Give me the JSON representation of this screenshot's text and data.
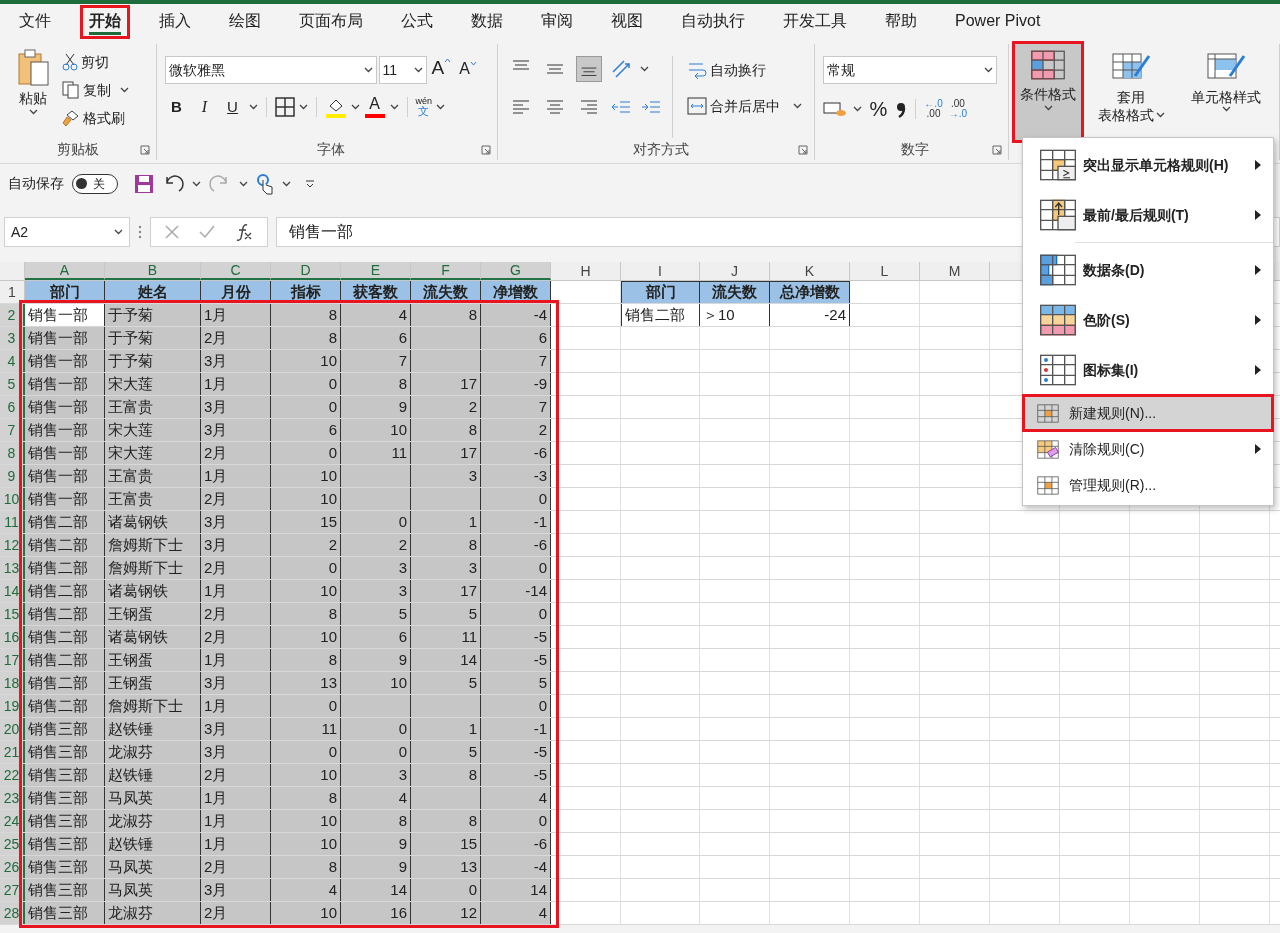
{
  "tabs": [
    {
      "label": "文件",
      "selected": false
    },
    {
      "label": "开始",
      "selected": true,
      "annotated": true
    },
    {
      "label": "插入",
      "selected": false
    },
    {
      "label": "绘图",
      "selected": false
    },
    {
      "label": "页面布局",
      "selected": false
    },
    {
      "label": "公式",
      "selected": false
    },
    {
      "label": "数据",
      "selected": false
    },
    {
      "label": "审阅",
      "selected": false
    },
    {
      "label": "视图",
      "selected": false
    },
    {
      "label": "自动执行",
      "selected": false
    },
    {
      "label": "开发工具",
      "selected": false
    },
    {
      "label": "帮助",
      "selected": false
    },
    {
      "label": "Power Pivot",
      "selected": false
    }
  ],
  "clipboard": {
    "paste": "粘贴",
    "cut": "剪切",
    "copy": "复制",
    "format_painter": "格式刷",
    "group_label": "剪贴板"
  },
  "font": {
    "font_name": "微软雅黑",
    "font_size": "11",
    "grow": "A",
    "shrink": "A",
    "bold": "B",
    "italic": "I",
    "underline": "U",
    "font_color": "A",
    "phonetic": [
      "wén",
      "文"
    ],
    "group_label": "字体"
  },
  "alignment": {
    "wrap_text": "自动换行",
    "merge_center": "合并后居中",
    "group_label": "对齐方式"
  },
  "number": {
    "format": "常规",
    "percent": "%",
    "increase_decimal": [
      "←.0",
      ".00"
    ],
    "decrease_decimal": [
      ".00",
      "→.0"
    ],
    "group_label": "数字"
  },
  "styles": {
    "conditional_formatting": {
      "label": "条件格式",
      "expanded": true,
      "annotated": true
    },
    "table_format": [
      "套用",
      "表格格式"
    ],
    "cell_styles": "单元格样式"
  },
  "quick_access": {
    "autosave_label": "自动保存",
    "autosave": {
      "on": false,
      "label": "关"
    }
  },
  "name_box": "A2",
  "formula": "销售一部",
  "column_headers": [
    "A",
    "B",
    "C",
    "D",
    "E",
    "F",
    "G",
    "H",
    "I",
    "J",
    "K",
    "L",
    "M"
  ],
  "row_numbers": [
    "1",
    "2",
    "3",
    "4",
    "5",
    "6",
    "7",
    "8",
    "9",
    "10",
    "11",
    "12",
    "13",
    "14",
    "15",
    "16",
    "17",
    "18",
    "19",
    "20",
    "21",
    "22",
    "23",
    "24",
    "25",
    "26",
    "27",
    "28"
  ],
  "main_table": {
    "selection_annotated": true,
    "header": [
      "部门",
      "姓名",
      "月份",
      "指标",
      "获客数",
      "流失数",
      "净增数"
    ],
    "rows": [
      {
        "selected": true,
        "active": true,
        "cells": [
          "销售一部",
          "于予菊",
          "1月",
          "8",
          "4",
          "8",
          "-4"
        ]
      },
      {
        "selected": true,
        "active": false,
        "cells": [
          "销售一部",
          "于予菊",
          "2月",
          "8",
          "6",
          "",
          "6"
        ]
      },
      {
        "selected": true,
        "active": false,
        "cells": [
          "销售一部",
          "于予菊",
          "3月",
          "10",
          "7",
          "",
          "7"
        ]
      },
      {
        "selected": true,
        "active": false,
        "cells": [
          "销售一部",
          "宋大莲",
          "1月",
          "0",
          "8",
          "17",
          "-9"
        ]
      },
      {
        "selected": true,
        "active": false,
        "cells": [
          "销售一部",
          "王富贵",
          "3月",
          "0",
          "9",
          "2",
          "7"
        ]
      },
      {
        "selected": true,
        "active": false,
        "cells": [
          "销售一部",
          "宋大莲",
          "3月",
          "6",
          "10",
          "8",
          "2"
        ]
      },
      {
        "selected": true,
        "active": false,
        "cells": [
          "销售一部",
          "宋大莲",
          "2月",
          "0",
          "11",
          "17",
          "-6"
        ]
      },
      {
        "selected": true,
        "active": false,
        "cells": [
          "销售一部",
          "王富贵",
          "1月",
          "10",
          "",
          "3",
          "-3"
        ]
      },
      {
        "selected": true,
        "active": false,
        "cells": [
          "销售一部",
          "王富贵",
          "2月",
          "10",
          "",
          "",
          "0"
        ]
      },
      {
        "selected": true,
        "active": false,
        "cells": [
          "销售二部",
          "诸葛钢铁",
          "3月",
          "15",
          "0",
          "1",
          "-1"
        ]
      },
      {
        "selected": true,
        "active": false,
        "cells": [
          "销售二部",
          "詹姆斯下士",
          "3月",
          "2",
          "2",
          "8",
          "-6"
        ]
      },
      {
        "selected": true,
        "active": false,
        "cells": [
          "销售二部",
          "詹姆斯下士",
          "2月",
          "0",
          "3",
          "3",
          "0"
        ]
      },
      {
        "selected": true,
        "active": false,
        "cells": [
          "销售二部",
          "诸葛钢铁",
          "1月",
          "10",
          "3",
          "17",
          "-14"
        ]
      },
      {
        "selected": true,
        "active": false,
        "cells": [
          "销售二部",
          "王钢蛋",
          "2月",
          "8",
          "5",
          "5",
          "0"
        ]
      },
      {
        "selected": true,
        "active": false,
        "cells": [
          "销售二部",
          "诸葛钢铁",
          "2月",
          "10",
          "6",
          "11",
          "-5"
        ]
      },
      {
        "selected": true,
        "active": false,
        "cells": [
          "销售二部",
          "王钢蛋",
          "1月",
          "8",
          "9",
          "14",
          "-5"
        ]
      },
      {
        "selected": true,
        "active": false,
        "cells": [
          "销售二部",
          "王钢蛋",
          "3月",
          "13",
          "10",
          "5",
          "5"
        ]
      },
      {
        "selected": true,
        "active": false,
        "cells": [
          "销售二部",
          "詹姆斯下士",
          "1月",
          "0",
          "",
          "",
          "0"
        ]
      },
      {
        "selected": true,
        "active": false,
        "cells": [
          "销售三部",
          "赵铁锤",
          "3月",
          "11",
          "0",
          "1",
          "-1"
        ]
      },
      {
        "selected": true,
        "active": false,
        "cells": [
          "销售三部",
          "龙淑芬",
          "3月",
          "0",
          "0",
          "5",
          "-5"
        ]
      },
      {
        "selected": true,
        "active": false,
        "cells": [
          "销售三部",
          "赵铁锤",
          "2月",
          "10",
          "3",
          "8",
          "-5"
        ]
      },
      {
        "selected": true,
        "active": false,
        "cells": [
          "销售三部",
          "马凤英",
          "1月",
          "8",
          "4",
          "",
          "4"
        ]
      },
      {
        "selected": true,
        "active": false,
        "cells": [
          "销售三部",
          "龙淑芬",
          "1月",
          "10",
          "8",
          "8",
          "0"
        ]
      },
      {
        "selected": true,
        "active": false,
        "cells": [
          "销售三部",
          "赵铁锤",
          "1月",
          "10",
          "9",
          "15",
          "-6"
        ]
      },
      {
        "selected": true,
        "active": false,
        "cells": [
          "销售三部",
          "马凤英",
          "2月",
          "8",
          "9",
          "13",
          "-4"
        ]
      },
      {
        "selected": true,
        "active": false,
        "cells": [
          "销售三部",
          "马凤英",
          "3月",
          "4",
          "14",
          "0",
          "14"
        ]
      },
      {
        "selected": true,
        "active": false,
        "cells": [
          "销售三部",
          "龙淑芬",
          "2月",
          "10",
          "16",
          "12",
          "4"
        ]
      }
    ]
  },
  "summary_table": {
    "header": [
      "部门",
      "流失数",
      "总净增数"
    ],
    "rows": [
      [
        "销售二部",
        "＞10",
        "-24"
      ]
    ]
  },
  "conditional_menu": [
    {
      "kind": "large",
      "label": "突出显示单元格规则(H)",
      "submenu": true,
      "selected": false
    },
    {
      "kind": "large",
      "label": "最前/最后规则(T)",
      "submenu": true,
      "selected": false
    },
    {
      "kind": "separator"
    },
    {
      "kind": "large",
      "label": "数据条(D)",
      "submenu": true,
      "selected": false
    },
    {
      "kind": "large",
      "label": "色阶(S)",
      "submenu": true,
      "selected": false
    },
    {
      "kind": "large",
      "label": "图标集(I)",
      "submenu": true,
      "selected": false
    },
    {
      "kind": "small",
      "label": "新建规则(N)...",
      "submenu": false,
      "selected": true,
      "annotated": true
    },
    {
      "kind": "small",
      "label": "清除规则(C)",
      "submenu": true,
      "selected": false
    },
    {
      "kind": "small",
      "label": "管理规则(R)...",
      "submenu": false,
      "selected": false
    }
  ]
}
